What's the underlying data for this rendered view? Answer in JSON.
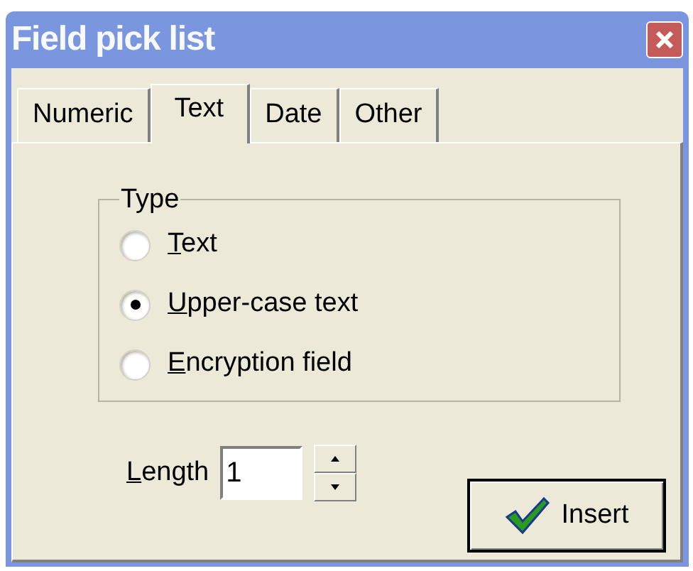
{
  "window": {
    "title": "Field pick list"
  },
  "tabs": [
    {
      "label": "Numeric",
      "selected": false
    },
    {
      "label": "Text",
      "selected": true
    },
    {
      "label": "Date",
      "selected": false
    },
    {
      "label": "Other",
      "selected": false
    }
  ],
  "type_group": {
    "label": "Type",
    "options": [
      {
        "label": "Text",
        "selected": false
      },
      {
        "label": "Upper-case text",
        "selected": true
      },
      {
        "label": "Encryption field",
        "selected": false
      }
    ]
  },
  "length": {
    "label": "Length",
    "value": "1"
  },
  "insert_button": {
    "label": "Insert"
  }
}
